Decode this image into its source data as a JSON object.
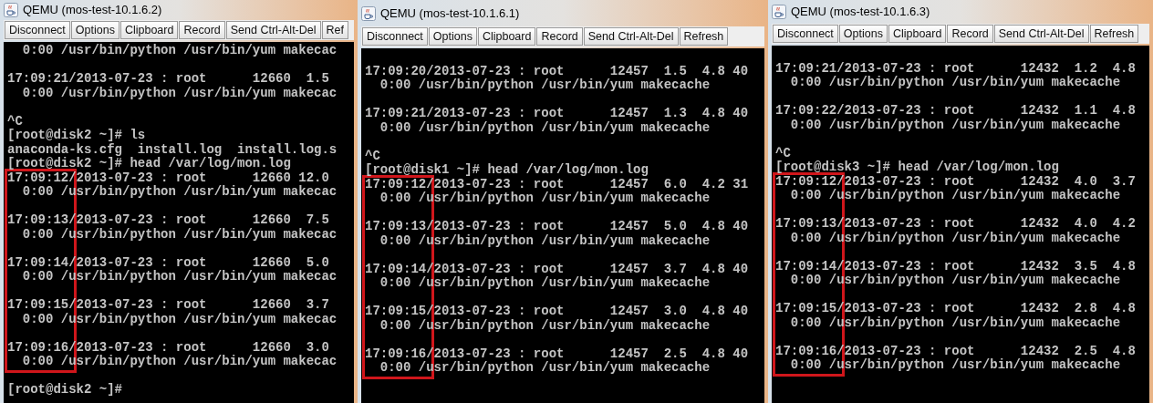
{
  "windows": [
    {
      "title": "QEMU (mos-test-10.1.6.2)",
      "buttons": [
        "Disconnect",
        "Options",
        "Clipboard",
        "Record",
        "Send Ctrl-Alt-Del",
        "Ref"
      ],
      "lines": [
        {
          "kind": "text",
          "text": "  0:00 /usr/bin/python /usr/bin/yum makecac"
        },
        {
          "kind": "blank"
        },
        {
          "kind": "text",
          "text": "17:09:21/2013-07-23 : root      12660  1.5"
        },
        {
          "kind": "text",
          "text": "  0:00 /usr/bin/python /usr/bin/yum makecac"
        },
        {
          "kind": "blank"
        },
        {
          "kind": "text",
          "text": "^C"
        },
        {
          "kind": "text",
          "text": "[root@disk2 ~]# ls"
        },
        {
          "kind": "text",
          "text": "anaconda-ks.cfg  install.log  install.log.s"
        },
        {
          "kind": "text",
          "text": "[root@disk2 ~]# head /var/log/mon.log"
        }
      ],
      "highlighted_lines": [
        {
          "kind": "text",
          "text": "17:09:12/2013-07-23 : root      12660 12.0"
        },
        {
          "kind": "text",
          "text": "  0:00 /usr/bin/python /usr/bin/yum makecac"
        },
        {
          "kind": "blank"
        },
        {
          "kind": "text",
          "text": "17:09:13/2013-07-23 : root      12660  7.5"
        },
        {
          "kind": "text",
          "text": "  0:00 /usr/bin/python /usr/bin/yum makecac"
        },
        {
          "kind": "blank"
        },
        {
          "kind": "text",
          "text": "17:09:14/2013-07-23 : root      12660  5.0"
        },
        {
          "kind": "text",
          "text": "  0:00 /usr/bin/python /usr/bin/yum makecac"
        },
        {
          "kind": "blank"
        },
        {
          "kind": "text",
          "text": "17:09:15/2013-07-23 : root      12660  3.7"
        },
        {
          "kind": "text",
          "text": "  0:00 /usr/bin/python /usr/bin/yum makecac"
        },
        {
          "kind": "blank"
        },
        {
          "kind": "text",
          "text": "17:09:16/2013-07-23 : root      12660  3.0"
        },
        {
          "kind": "text",
          "text": "  0:00 /usr/bin/python /usr/bin/yum makecac"
        }
      ],
      "trailing_lines": [
        {
          "kind": "blank"
        },
        {
          "kind": "text",
          "text": "[root@disk2 ~]#"
        }
      ]
    },
    {
      "title": "QEMU (mos-test-10.1.6.1)",
      "buttons": [
        "Disconnect",
        "Options",
        "Clipboard",
        "Record",
        "Send Ctrl-Alt-Del",
        "Refresh"
      ],
      "lines": [
        {
          "kind": "blank"
        },
        {
          "kind": "text",
          "text": "17:09:20/2013-07-23 : root      12457  1.5  4.8 40"
        },
        {
          "kind": "text",
          "text": "  0:00 /usr/bin/python /usr/bin/yum makecache"
        },
        {
          "kind": "blank"
        },
        {
          "kind": "text",
          "text": "17:09:21/2013-07-23 : root      12457  1.3  4.8 40"
        },
        {
          "kind": "text",
          "text": "  0:00 /usr/bin/python /usr/bin/yum makecache"
        },
        {
          "kind": "blank"
        },
        {
          "kind": "text",
          "text": "^C"
        },
        {
          "kind": "text",
          "text": "[root@disk1 ~]# head /var/log/mon.log"
        }
      ],
      "highlighted_lines": [
        {
          "kind": "text",
          "text": "17:09:12/2013-07-23 : root      12457  6.0  4.2 31"
        },
        {
          "kind": "text",
          "text": "  0:00 /usr/bin/python /usr/bin/yum makecache"
        },
        {
          "kind": "blank"
        },
        {
          "kind": "text",
          "text": "17:09:13/2013-07-23 : root      12457  5.0  4.8 40"
        },
        {
          "kind": "text",
          "text": "  0:00 /usr/bin/python /usr/bin/yum makecache"
        },
        {
          "kind": "blank"
        },
        {
          "kind": "text",
          "text": "17:09:14/2013-07-23 : root      12457  3.7  4.8 40"
        },
        {
          "kind": "text",
          "text": "  0:00 /usr/bin/python /usr/bin/yum makecache"
        },
        {
          "kind": "blank"
        },
        {
          "kind": "text",
          "text": "17:09:15/2013-07-23 : root      12457  3.0  4.8 40"
        },
        {
          "kind": "text",
          "text": "  0:00 /usr/bin/python /usr/bin/yum makecache"
        },
        {
          "kind": "blank"
        },
        {
          "kind": "text",
          "text": "17:09:16/2013-07-23 : root      12457  2.5  4.8 40"
        },
        {
          "kind": "text",
          "text": "  0:00 /usr/bin/python /usr/bin/yum makecache"
        }
      ]
    },
    {
      "title": "QEMU (mos-test-10.1.6.3)",
      "buttons": [
        "Disconnect",
        "Options",
        "Clipboard",
        "Record",
        "Send Ctrl-Alt-Del",
        "Refresh"
      ],
      "lines": [
        {
          "kind": "blank"
        },
        {
          "kind": "text",
          "text": "17:09:21/2013-07-23 : root      12432  1.2  4.8"
        },
        {
          "kind": "text",
          "text": "  0:00 /usr/bin/python /usr/bin/yum makecache"
        },
        {
          "kind": "blank"
        },
        {
          "kind": "text",
          "text": "17:09:22/2013-07-23 : root      12432  1.1  4.8"
        },
        {
          "kind": "text",
          "text": "  0:00 /usr/bin/python /usr/bin/yum makecache"
        },
        {
          "kind": "blank"
        },
        {
          "kind": "text",
          "text": "^C"
        },
        {
          "kind": "text",
          "text": "[root@disk3 ~]# head /var/log/mon.log"
        }
      ],
      "highlighted_lines": [
        {
          "kind": "text",
          "text": "17:09:12/2013-07-23 : root      12432  4.0  3.7"
        },
        {
          "kind": "text",
          "text": "  0:00 /usr/bin/python /usr/bin/yum makecache"
        },
        {
          "kind": "blank"
        },
        {
          "kind": "text",
          "text": "17:09:13/2013-07-23 : root      12432  4.0  4.2"
        },
        {
          "kind": "text",
          "text": "  0:00 /usr/bin/python /usr/bin/yum makecache"
        },
        {
          "kind": "blank"
        },
        {
          "kind": "text",
          "text": "17:09:14/2013-07-23 : root      12432  3.5  4.8"
        },
        {
          "kind": "text",
          "text": "  0:00 /usr/bin/python /usr/bin/yum makecache"
        },
        {
          "kind": "blank"
        },
        {
          "kind": "text",
          "text": "17:09:15/2013-07-23 : root      12432  2.8  4.8"
        },
        {
          "kind": "text",
          "text": "  0:00 /usr/bin/python /usr/bin/yum makecache"
        },
        {
          "kind": "blank"
        },
        {
          "kind": "text",
          "text": "17:09:16/2013-07-23 : root      12432  2.5  4.8"
        },
        {
          "kind": "text",
          "text": "  0:00 /usr/bin/python /usr/bin/yum makecache"
        }
      ]
    }
  ]
}
